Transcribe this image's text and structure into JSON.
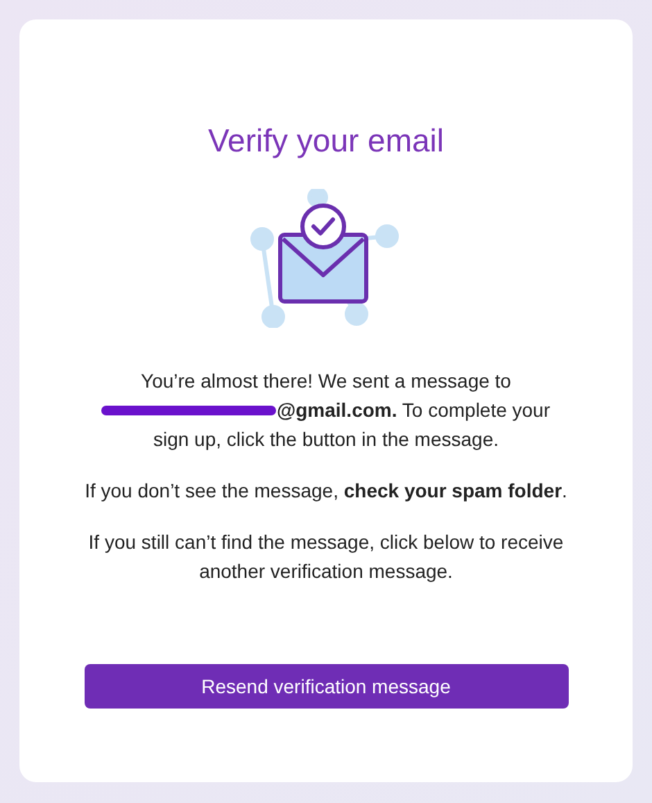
{
  "title": "Verify your email",
  "paragraphs": [
    {
      "kind": "redacted",
      "before": "You’re almost there! We sent a message to",
      "after": "**@gmail.com.** To complete your",
      "rest": "sign up, click the button in the message."
    },
    {
      "kind": "plain",
      "text": "If you don’t see the message, **check your spam folder**."
    },
    {
      "kind": "plain",
      "text": "If you still can’t find the message, click below to receive another verification message."
    }
  ],
  "button": "Resend verification message"
}
